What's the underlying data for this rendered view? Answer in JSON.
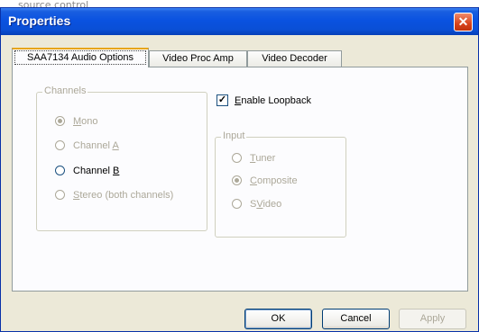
{
  "caption": "source control",
  "window": {
    "title": "Properties",
    "close_glyph": "✕"
  },
  "tabs": [
    {
      "label": "SAA7134 Audio Options",
      "active": true
    },
    {
      "label": "Video Proc Amp",
      "active": false
    },
    {
      "label": "Video Decoder",
      "active": false
    }
  ],
  "channels": {
    "legend": "Channels",
    "options": [
      {
        "pre": "",
        "key": "M",
        "post": "ono",
        "selected": true,
        "enabled": false
      },
      {
        "pre": "Channel ",
        "key": "A",
        "post": "",
        "selected": false,
        "enabled": false
      },
      {
        "pre": "Channel ",
        "key": "B",
        "post": "",
        "selected": false,
        "enabled": true
      },
      {
        "pre": "",
        "key": "S",
        "post": "tereo (both channels)",
        "selected": false,
        "enabled": false
      }
    ]
  },
  "loopback": {
    "key": "E",
    "rest": "nable Loopback",
    "checked": true,
    "check_glyph": "✓"
  },
  "input": {
    "legend": "Input",
    "options": [
      {
        "pre": "",
        "key": "T",
        "post": "uner",
        "selected": false,
        "enabled": false
      },
      {
        "pre": "",
        "key": "C",
        "post": "omposite",
        "selected": true,
        "enabled": false
      },
      {
        "pre": "S",
        "key": "V",
        "post": "ideo",
        "selected": false,
        "enabled": false
      }
    ]
  },
  "buttons": {
    "ok": "OK",
    "cancel": "Cancel",
    "apply": "Apply"
  }
}
